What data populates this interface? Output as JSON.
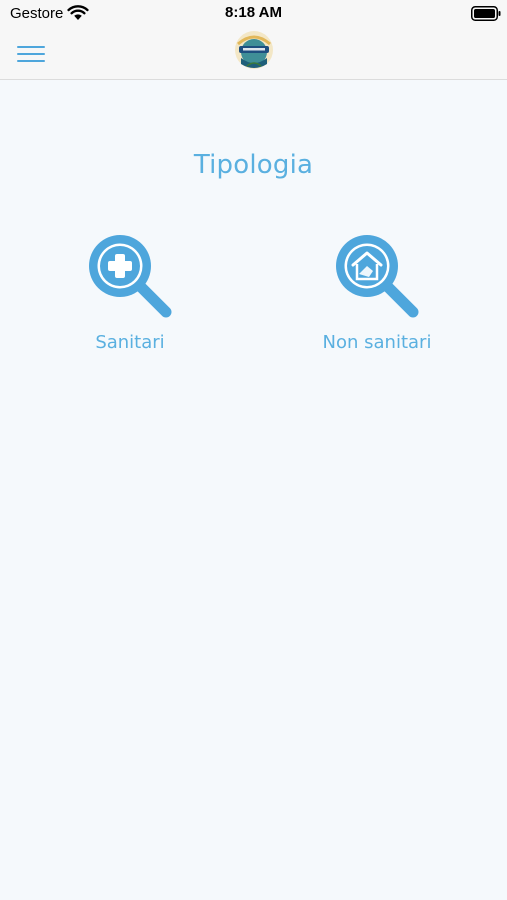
{
  "status_bar": {
    "carrier": "Gestore",
    "time": "8:18 AM"
  },
  "header": {
    "menu_icon": "hamburger-icon",
    "logo_icon": "app-logo"
  },
  "main": {
    "title": "Tipologia",
    "categories": [
      {
        "label": "Sanitari",
        "icon": "magnifier-plus-icon"
      },
      {
        "label": "Non sanitari",
        "icon": "magnifier-house-icon"
      }
    ]
  },
  "colors": {
    "accent": "#4ea6dc",
    "text_accent": "#5ab0e0",
    "background": "#f5f9fc",
    "bar_background": "#f7f7f7"
  }
}
